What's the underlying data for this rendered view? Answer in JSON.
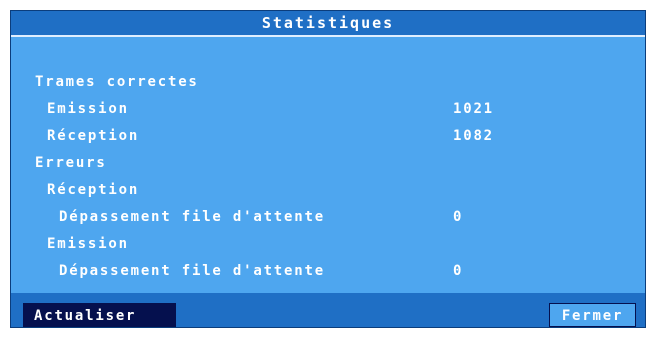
{
  "window": {
    "title": "Statistiques"
  },
  "stats": {
    "trames_correctes": "Trames correctes",
    "emission_label": "Emission",
    "emission_value": "1021",
    "reception_label": "Réception",
    "reception_value": "1082",
    "erreurs": "Erreurs",
    "erreurs_reception": "Réception",
    "depassement_reception_label": "Dépassement file d'attente",
    "depassement_reception_value": "0",
    "erreurs_emission": "Emission",
    "depassement_emission_label": "Dépassement file d'attente",
    "depassement_emission_value": "0"
  },
  "buttons": {
    "actualiser": "Actualiser",
    "fermer": "Fermer"
  },
  "colors": {
    "panel": "#4ea6ef",
    "bar": "#1f6fc5",
    "button_selected": "#05104e",
    "text": "#ffffff"
  }
}
